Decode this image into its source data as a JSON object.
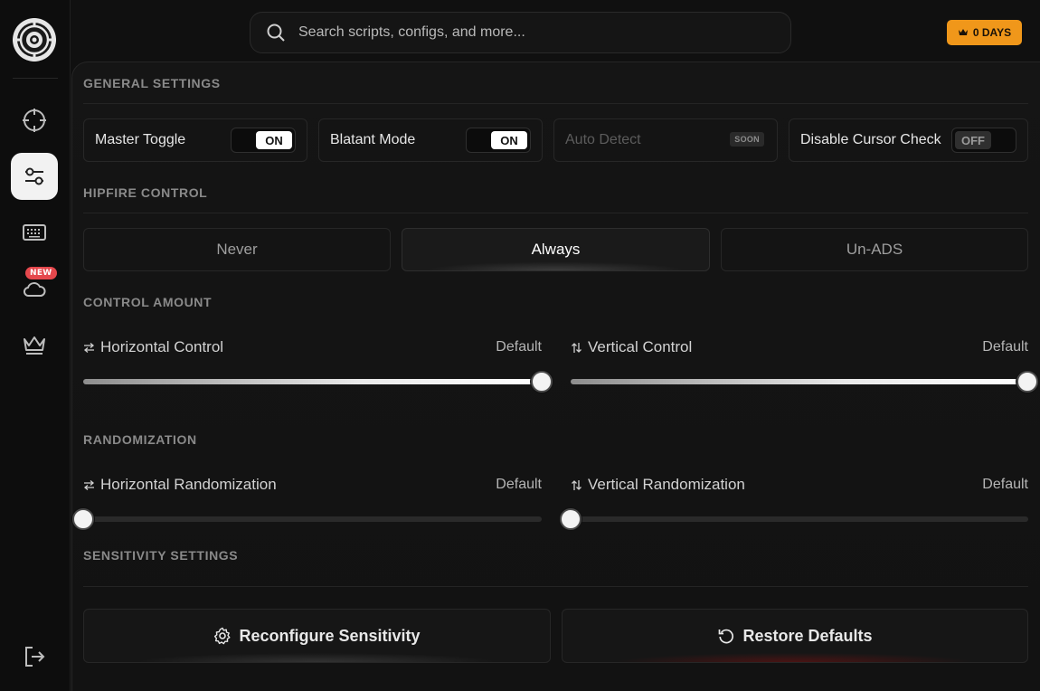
{
  "search": {
    "placeholder": "Search scripts, configs, and more..."
  },
  "subscription": {
    "label": "0 DAYS",
    "icon": "crown-icon",
    "color": "#f0971a"
  },
  "sidebar": {
    "items": [
      {
        "name": "crosshair",
        "icon": "crosshair-icon",
        "active": false
      },
      {
        "name": "settings",
        "icon": "sliders-icon",
        "active": true
      },
      {
        "name": "keybinds",
        "icon": "keyboard-icon",
        "active": false
      },
      {
        "name": "cloud",
        "icon": "cloud-icon",
        "active": false,
        "badge": "NEW"
      },
      {
        "name": "premium",
        "icon": "crown-icon",
        "active": false
      }
    ],
    "logout_icon": "logout-icon"
  },
  "general": {
    "title": "GENERAL SETTINGS",
    "toggles": [
      {
        "label": "Master Toggle",
        "state": "ON"
      },
      {
        "label": "Blatant Mode",
        "state": "ON"
      },
      {
        "label": "Auto Detect",
        "state": "SOON"
      },
      {
        "label": "Disable Cursor Check",
        "state": "OFF"
      }
    ]
  },
  "hipfire": {
    "title": "HIPFIRE CONTROL",
    "options": [
      "Never",
      "Always",
      "Un-ADS"
    ],
    "selected": "Always"
  },
  "control_amount": {
    "title": "CONTROL AMOUNT",
    "horizontal": {
      "label": "Horizontal Control",
      "value_label": "Default",
      "value": 1.0
    },
    "vertical": {
      "label": "Vertical Control",
      "value_label": "Default",
      "value": 1.0
    }
  },
  "randomization": {
    "title": "RANDOMIZATION",
    "horizontal": {
      "label": "Horizontal Randomization",
      "value_label": "Default",
      "value": 0.0
    },
    "vertical": {
      "label": "Vertical Randomization",
      "value_label": "Default",
      "value": 0.0
    }
  },
  "sensitivity": {
    "title": "SENSITIVITY SETTINGS",
    "reconfigure_label": "Reconfigure Sensitivity",
    "restore_label": "Restore Defaults"
  }
}
